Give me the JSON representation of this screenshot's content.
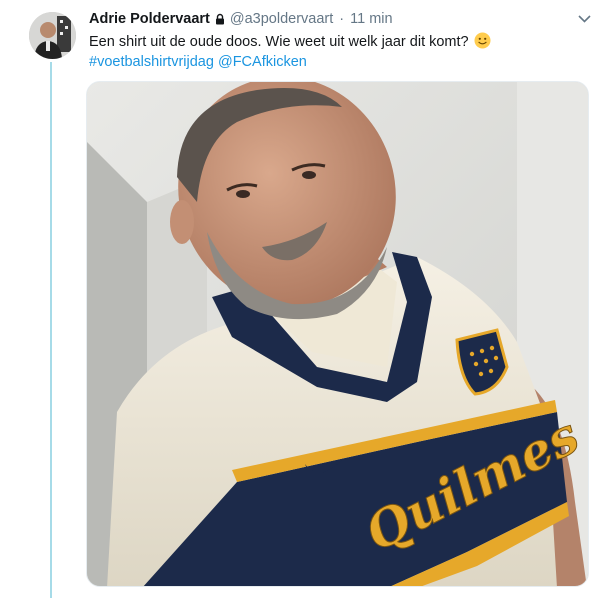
{
  "tweet": {
    "author_name": "Adrie Poldervaart",
    "handle": "@a3poldervaart",
    "separator": "·",
    "time": "11 min",
    "text": "Een shirt uit de oude doos. Wie weet uit welk jaar dit komt?",
    "emoji": "smiling-face-emoji",
    "hashtag": "#voetbalshirtvrijdag",
    "mention": "@FCAfkicken",
    "shirt_text": "Quilmes"
  },
  "icons": {
    "lock": "lock-icon",
    "caret": "chevron-down-icon"
  },
  "colors": {
    "link": "#1b95e0",
    "thread_line": "#a6dbe8",
    "secondary_text": "#657786",
    "shirt_navy": "#1c2a4a",
    "shirt_gold": "#e6a82a",
    "shirt_cream": "#f4efe2"
  }
}
